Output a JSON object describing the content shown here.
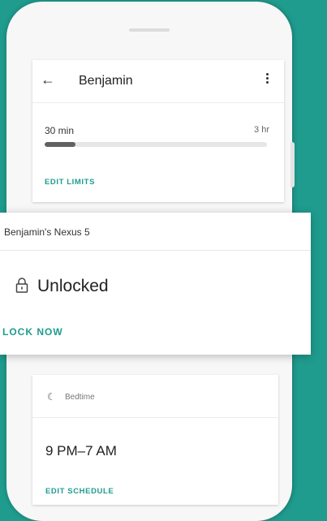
{
  "colors": {
    "accent": "#1f9c8e",
    "background": "#1f9c8e"
  },
  "header": {
    "title": "Benjamin",
    "back_icon": "arrow-left-icon",
    "menu_icon": "more-vert-icon"
  },
  "limits": {
    "current": "30 min",
    "max": "3 hr",
    "progress_fraction": 0.14,
    "edit_label": "EDIT LIMITS"
  },
  "device_card": {
    "device_name": "Benjamin's Nexus 5",
    "status_icon": "lock-open-icon",
    "status": "Unlocked",
    "action_label": "LOCK NOW"
  },
  "bedtime": {
    "icon": "moon-icon",
    "label": "Bedtime",
    "time": "9 PM–7 AM",
    "edit_label": "EDIT SCHEDULE"
  }
}
